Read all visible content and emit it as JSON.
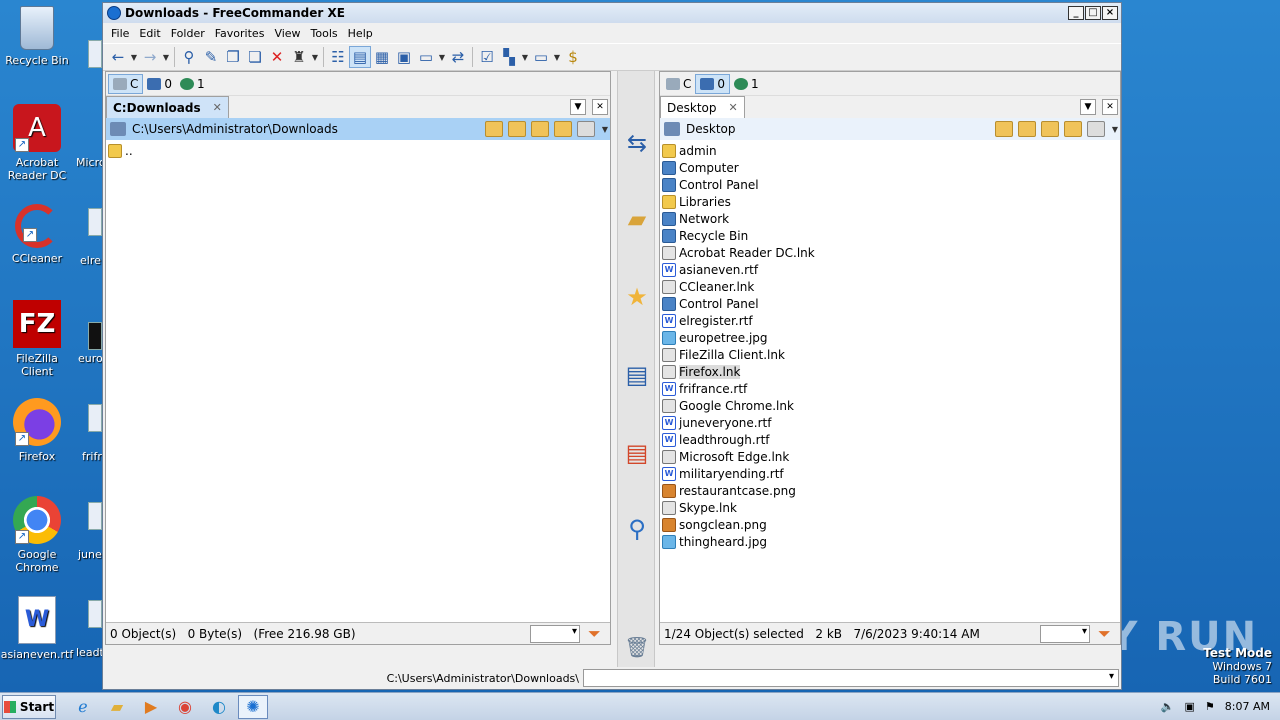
{
  "desktop": {
    "icons": [
      {
        "label": "Recycle Bin",
        "icon": "recycle-bin-icon"
      },
      {
        "label": "Acrobat Reader DC",
        "icon": "acrobat-icon"
      },
      {
        "label": "CCleaner",
        "icon": "ccleaner-icon"
      },
      {
        "label": "FileZilla Client",
        "icon": "filezilla-icon"
      },
      {
        "label": "Firefox",
        "icon": "firefox-icon"
      },
      {
        "label": "Google Chrome",
        "icon": "chrome-icon"
      },
      {
        "label": "asianeven.rtf",
        "icon": "word-doc-icon"
      }
    ],
    "peek_labels": [
      "Micro",
      "elre",
      "euro",
      "frifr",
      "june",
      "leadt"
    ],
    "watermark": {
      "line1": "Test Mode",
      "line2": "Windows 7",
      "line3": "Build 7601"
    },
    "anyrun": "ANY RUN"
  },
  "window": {
    "title": "Downloads - FreeCommander XE",
    "menu": [
      "File",
      "Edit",
      "Folder",
      "Favorites",
      "View",
      "Tools",
      "Help"
    ]
  },
  "left_panel": {
    "drives": [
      {
        "label": "C"
      },
      {
        "label": "0"
      },
      {
        "label": "1"
      }
    ],
    "tab": "C:Downloads",
    "path": "C:\\Users\\Administrator\\Downloads",
    "files": [
      {
        "name": ".."
      }
    ],
    "status": "0 Object(s)   0 Byte(s)   (Free 216.98 GB)"
  },
  "right_panel": {
    "drives": [
      {
        "label": "C"
      },
      {
        "label": "0"
      },
      {
        "label": "1"
      }
    ],
    "tab": "Desktop",
    "path": "Desktop",
    "files": [
      {
        "name": "admin",
        "type": "folder"
      },
      {
        "name": "Computer",
        "type": "sys"
      },
      {
        "name": "Control Panel",
        "type": "sys"
      },
      {
        "name": "Libraries",
        "type": "folder"
      },
      {
        "name": "Network",
        "type": "sys"
      },
      {
        "name": "Recycle Bin",
        "type": "sys"
      },
      {
        "name": "Acrobat Reader DC.lnk",
        "type": "lnk"
      },
      {
        "name": "asianeven.rtf",
        "type": "rtf"
      },
      {
        "name": "CCleaner.lnk",
        "type": "lnk"
      },
      {
        "name": "Control Panel",
        "type": "sys"
      },
      {
        "name": "elregister.rtf",
        "type": "rtf"
      },
      {
        "name": "europetree.jpg",
        "type": "img"
      },
      {
        "name": "FileZilla Client.lnk",
        "type": "lnk"
      },
      {
        "name": "Firefox.lnk",
        "type": "lnk"
      },
      {
        "name": "frifrance.rtf",
        "type": "rtf"
      },
      {
        "name": "Google Chrome.lnk",
        "type": "lnk"
      },
      {
        "name": "juneveryone.rtf",
        "type": "rtf"
      },
      {
        "name": "leadthrough.rtf",
        "type": "rtf"
      },
      {
        "name": "Microsoft Edge.lnk",
        "type": "lnk"
      },
      {
        "name": "militaryending.rtf",
        "type": "rtf"
      },
      {
        "name": "restaurantcase.png",
        "type": "png"
      },
      {
        "name": "Skype.lnk",
        "type": "lnk"
      },
      {
        "name": "songclean.png",
        "type": "png"
      },
      {
        "name": "thingheard.jpg",
        "type": "img"
      }
    ],
    "highlighted": "Firefox.lnk",
    "status": "1/24 Object(s) selected   2 kB   7/6/2023 9:40:14 AM"
  },
  "command_line": {
    "path": "C:\\Users\\Administrator\\Downloads\\"
  },
  "taskbar": {
    "start": "Start",
    "clock": "8:07 AM"
  },
  "colors": {
    "active_path": "#a9d1f5",
    "active_tab": "#cfe3f8",
    "desktop": "#1e73be"
  }
}
